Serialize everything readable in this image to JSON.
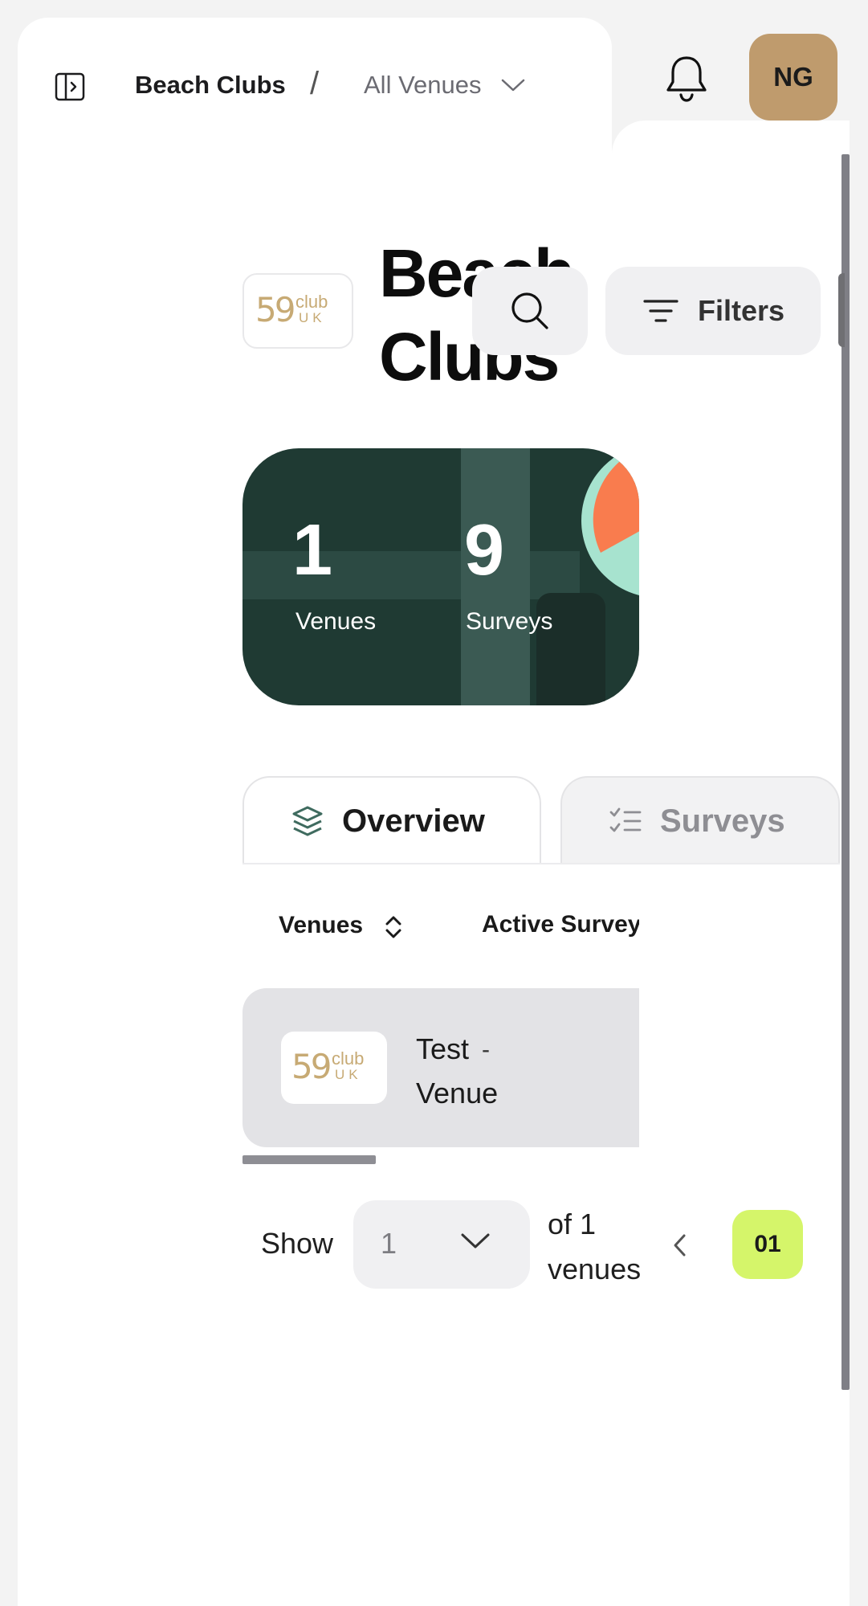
{
  "header": {
    "breadcrumb_main": "Beach Clubs",
    "breadcrumb_sep": "/",
    "venue_selector": "All Venues",
    "avatar_initials": "NG",
    "avatar_color": "#bf9b6d"
  },
  "logo": {
    "number": "59",
    "club": "club",
    "uk": "UK"
  },
  "main": {
    "title": "Beach Clubs",
    "filters_label": "Filters"
  },
  "stats": [
    {
      "value": "1",
      "label": "Venues"
    },
    {
      "value": "9",
      "label": "Surveys"
    }
  ],
  "tabs": [
    {
      "label": "Overview",
      "active": true
    },
    {
      "label": "Surveys",
      "active": false
    }
  ],
  "table": {
    "columns": [
      "Venues",
      "Active Surveys"
    ],
    "rows": [
      {
        "name": "Test Venue",
        "active_surveys": "-"
      }
    ]
  },
  "pagination": {
    "show_label": "Show",
    "per_page": "1",
    "summary": "of 1 venues",
    "current_page": "01"
  },
  "colors": {
    "accent": "#d5f56a",
    "card": "#1f3a33",
    "pie_orange": "#f97c4e",
    "pie_mint": "#a7e3cf"
  }
}
